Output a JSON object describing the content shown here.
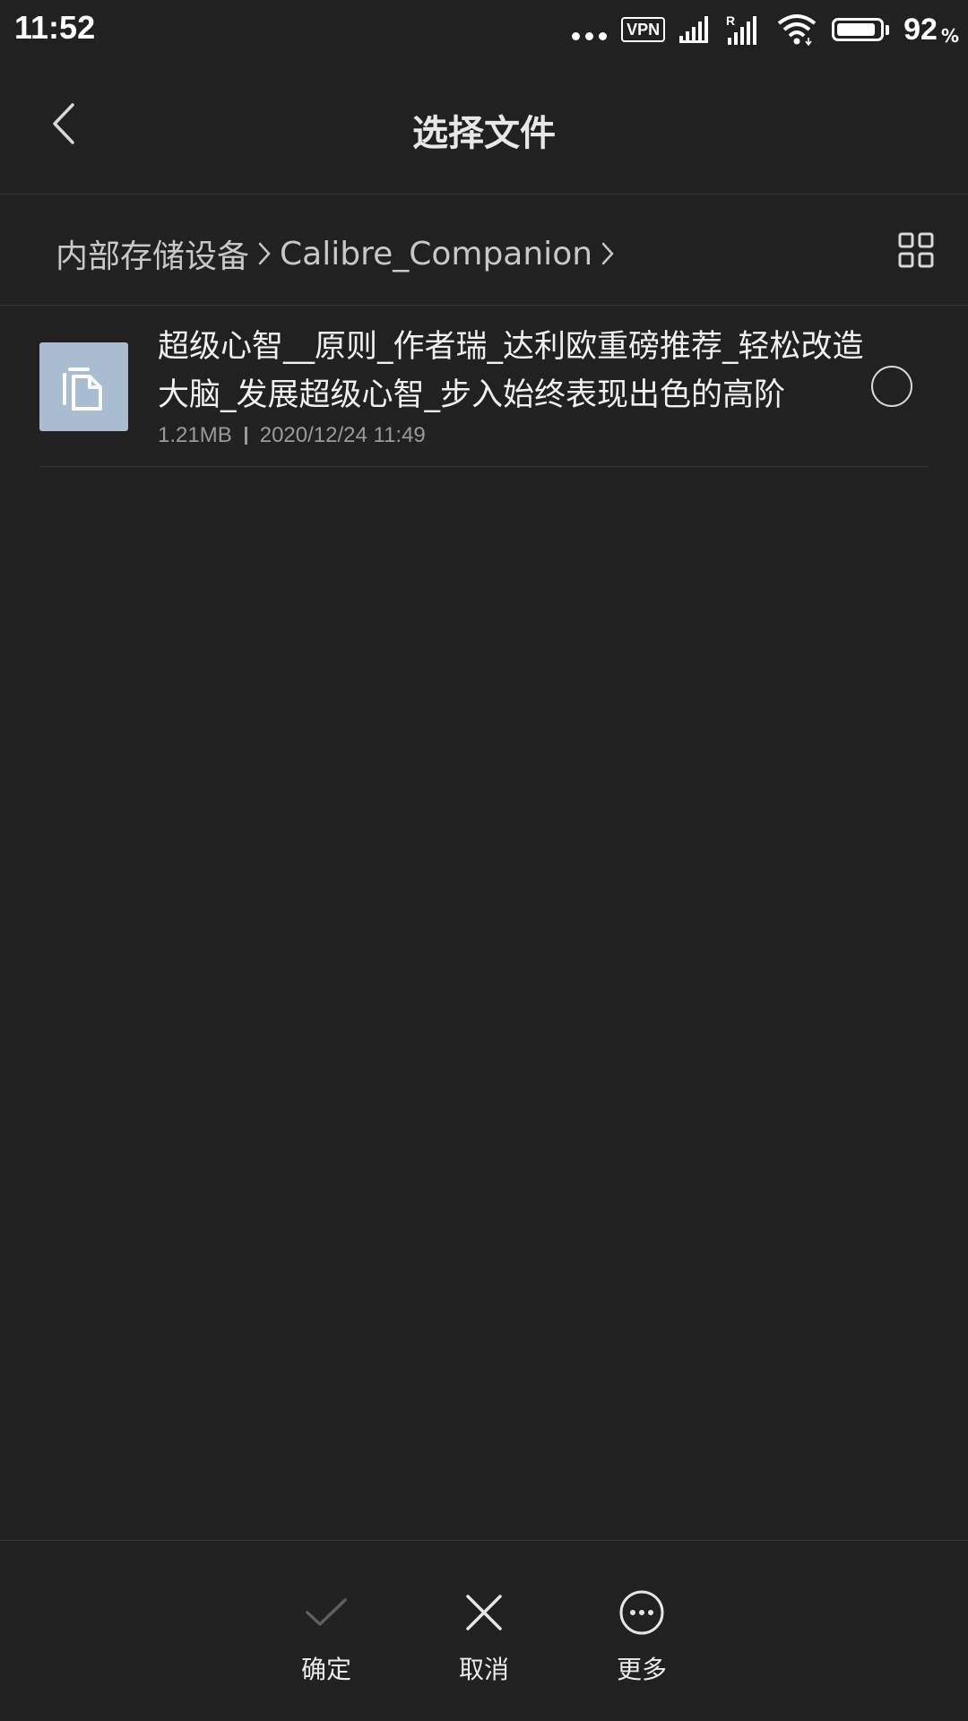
{
  "status_bar": {
    "time": "11:52",
    "vpn_label": "VPN",
    "battery_percent": "92",
    "battery_percent_sign": "%",
    "battery_level": 0.92,
    "icons": [
      "more-dots-icon",
      "vpn-icon",
      "signal-icon",
      "roaming-signal-icon",
      "wifi-icon",
      "battery-icon"
    ]
  },
  "header": {
    "title": "选择文件",
    "back_icon": "chevron-left-icon"
  },
  "breadcrumb": {
    "items": [
      "内部存储设备",
      "Calibre_Companion"
    ],
    "view_toggle_icon": "grid-view-icon"
  },
  "files": [
    {
      "name": "超级心智__原则_作者瑞_达利欧重磅推荐_轻松改造大脑_发展超级心智_步入始终表现出色的高阶",
      "size": "1.21MB",
      "modified": "2020/12/24 11:49",
      "icon": "document-copy-icon",
      "selected": false
    }
  ],
  "bottom_actions": [
    {
      "label": "确定",
      "icon": "checkmark-icon",
      "enabled": false
    },
    {
      "label": "取消",
      "icon": "close-icon",
      "enabled": true
    },
    {
      "label": "更多",
      "icon": "more-circle-icon",
      "enabled": true
    }
  ],
  "colors": {
    "background": "#212121",
    "divider": "#353535",
    "file_icon_bg": "#a9bcd0",
    "text_primary": "#f0f0f0",
    "text_secondary": "#9a9a9a"
  }
}
